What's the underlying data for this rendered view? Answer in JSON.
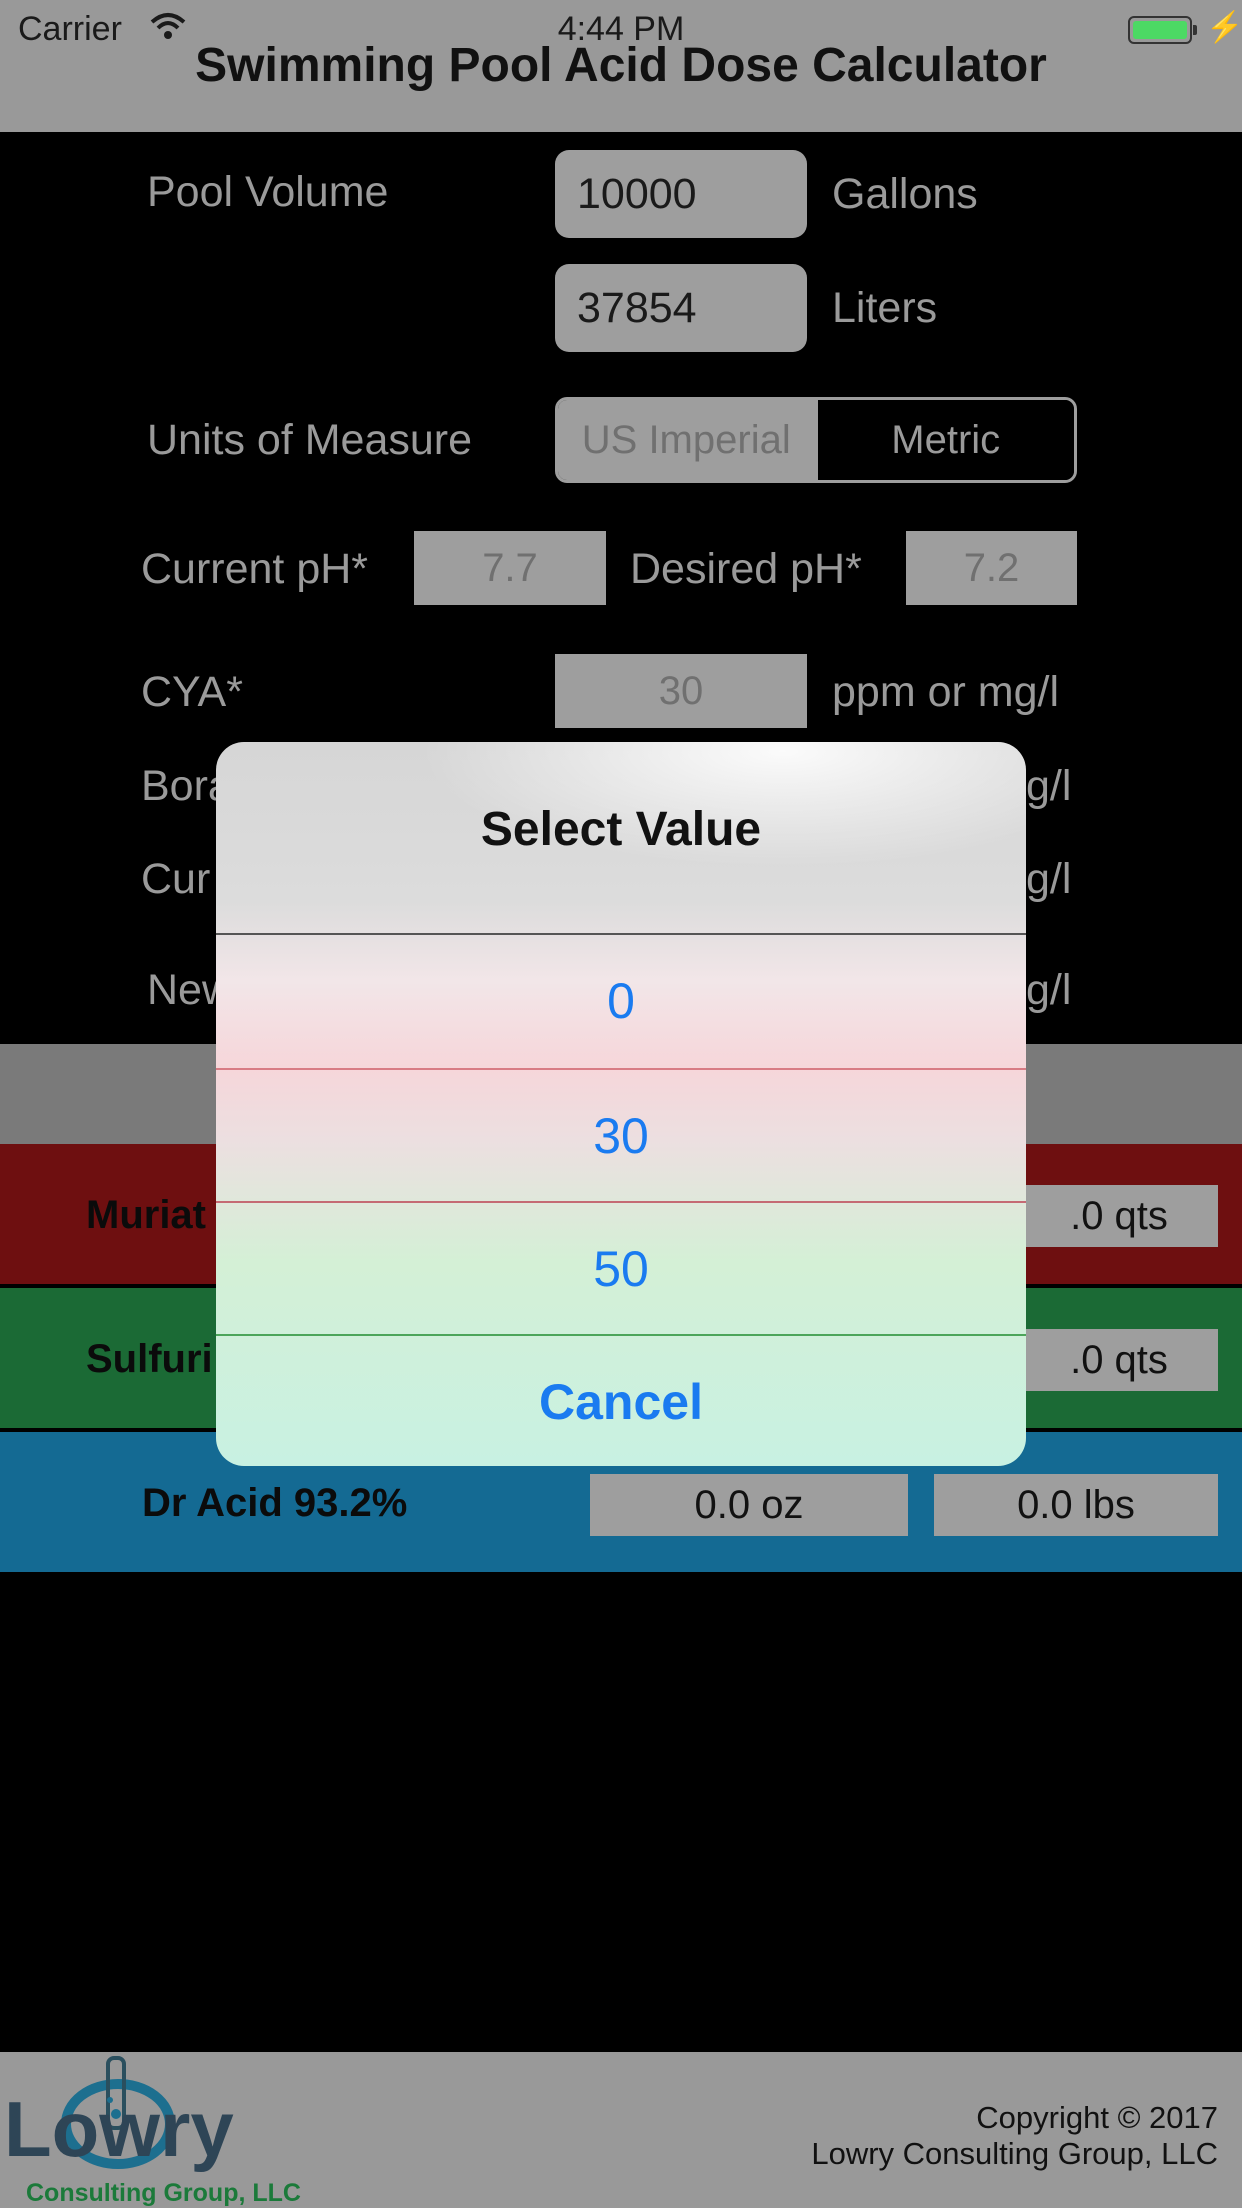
{
  "status_bar": {
    "carrier": "Carrier",
    "time": "4:44 PM"
  },
  "app": {
    "title": "Swimming Pool Acid Dose Calculator"
  },
  "form": {
    "pool_volume_label": "Pool Volume",
    "gallons_value": "10000",
    "gallons_unit": "Gallons",
    "liters_value": "37854",
    "liters_unit": "Liters",
    "units_label": "Units of Measure",
    "units_options": [
      "US Imperial",
      "Metric"
    ],
    "units_selected": "US Imperial",
    "current_ph_label": "Current pH*",
    "current_ph_value": "7.7",
    "desired_ph_label": "Desired pH*",
    "desired_ph_value": "7.2",
    "cya_label": "CYA*",
    "cya_value": "30",
    "cya_unit": "ppm or mg/l",
    "row_borate_label_visible": "Bora",
    "row_borate_unit_visible": "g/l",
    "row_current_label_visible": "Cur",
    "row_current_unit_visible": "g/l",
    "row_new_label_visible": "New",
    "row_new_unit_visible": "g/l"
  },
  "results": {
    "muriatic_label_visible": "Muriat",
    "muriatic_qts_visible": ".0 qts",
    "sulfuric_label_visible": "Sulfuri",
    "sulfuric_qts_visible": ".0 qts",
    "dr_acid_label": "Dr Acid 93.2%",
    "dr_acid_oz": "0.0 oz",
    "dr_acid_lbs": "0.0 lbs"
  },
  "alert": {
    "title": "Select Value",
    "options": [
      "0",
      "30",
      "50"
    ],
    "cancel_label": "Cancel"
  },
  "footer": {
    "logo_text": "Lowry",
    "logo_subtext": "Consulting Group, LLC",
    "copyright_line1": "Copyright © 2017",
    "copyright_line2": "Lowry Consulting Group, LLC"
  },
  "colors": {
    "header_bg": "#999999",
    "red_band": "#6e0f10",
    "green_band": "#1b6a35",
    "blue_band": "#146a93",
    "alert_button": "#1a7bf0"
  }
}
